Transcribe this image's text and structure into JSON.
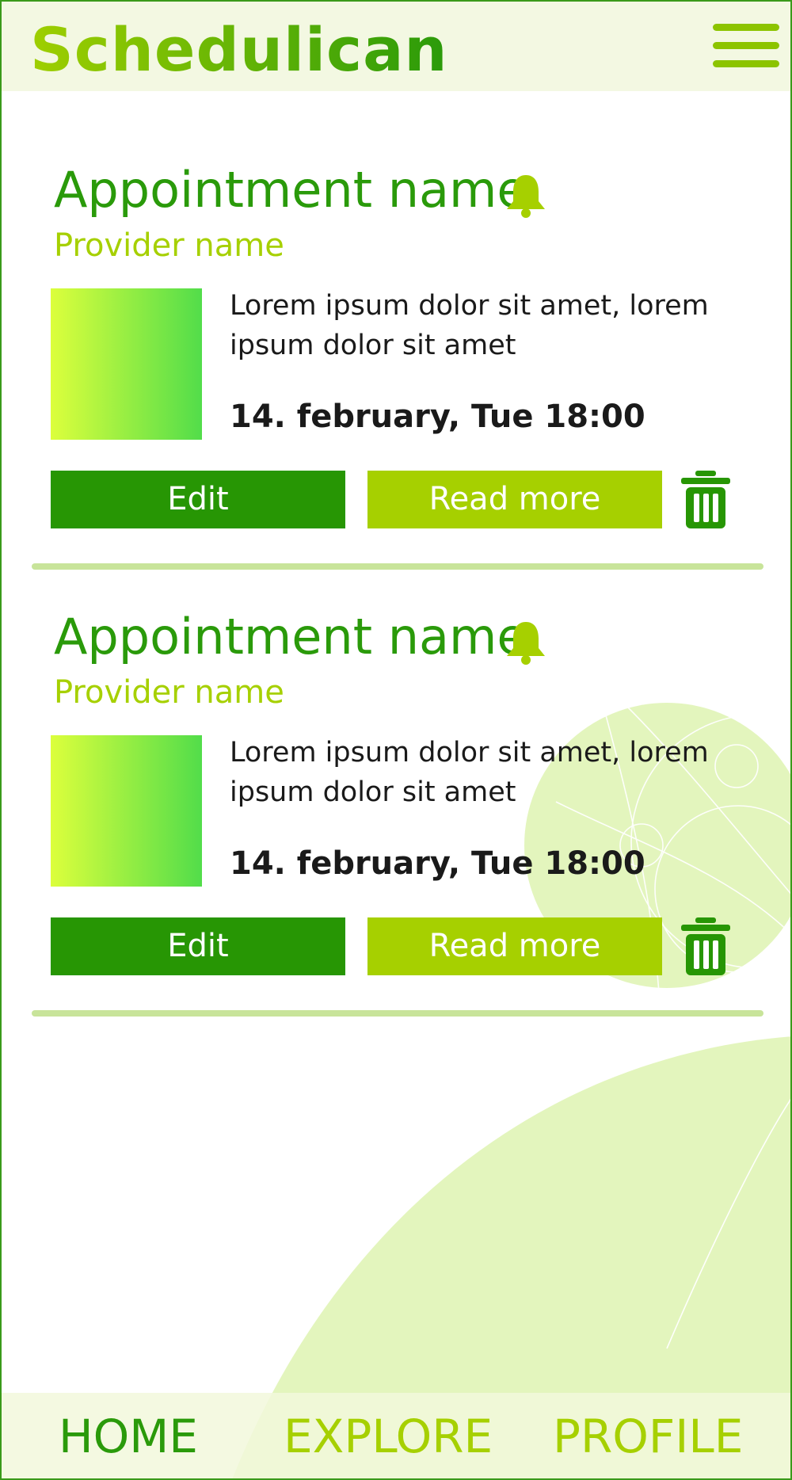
{
  "app": {
    "name": "Schedulican",
    "colors": {
      "primary": "#279604",
      "accent": "#a6d000",
      "header_bg": "#f3f8e2",
      "decor": "#e3f5bd"
    }
  },
  "header": {
    "menu_icon": "hamburger-menu-icon"
  },
  "appointments": [
    {
      "title": "Appointment name",
      "provider": "Provider name",
      "description": "Lorem ipsum dolor sit amet, lorem ipsum dolor sit amet",
      "date": "14. february, Tue 18:00",
      "edit_label": "Edit",
      "read_more_label": "Read more",
      "bell_icon": "bell-icon",
      "delete_icon": "trash-icon"
    },
    {
      "title": "Appointment name",
      "provider": "Provider name",
      "description": "Lorem ipsum dolor sit amet, lorem ipsum dolor sit amet",
      "date": "14. february, Tue 18:00",
      "edit_label": "Edit",
      "read_more_label": "Read more",
      "bell_icon": "bell-icon",
      "delete_icon": "trash-icon"
    }
  ],
  "bottom_nav": {
    "items": [
      {
        "label": "HOME",
        "active": true
      },
      {
        "label": "EXPLORE",
        "active": false
      },
      {
        "label": "PROFILE",
        "active": false
      }
    ]
  }
}
